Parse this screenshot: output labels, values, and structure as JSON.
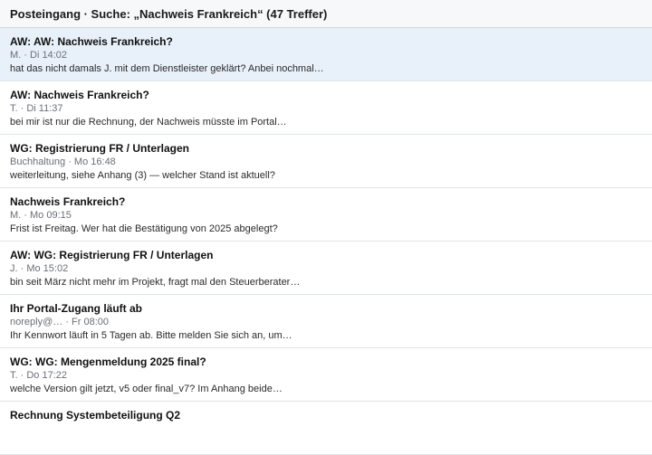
{
  "header": {
    "title": "Posteingang · Suche: „Nachweis Frankreich“ (47 Treffer)"
  },
  "messages": [
    {
      "subject": "AW: AW: Nachweis Frankreich?",
      "meta": "M. · Di 14:02",
      "preview": "hat das nicht damals J. mit dem Dienstleister geklärt? Anbei nochmal…",
      "selected": true
    },
    {
      "subject": "AW: Nachweis Frankreich?",
      "meta": "T. · Di 11:37",
      "preview": "bei mir ist nur die Rechnung, der Nachweis müsste im Portal…"
    },
    {
      "subject": "WG: Registrierung FR / Unterlagen",
      "meta": "Buchhaltung · Mo 16:48",
      "preview": "weiterleitung, siehe Anhang (3) — welcher Stand ist aktuell?"
    },
    {
      "subject": "Nachweis Frankreich?",
      "meta": "M. · Mo 09:15",
      "preview": "Frist ist Freitag. Wer hat die Bestätigung von 2025 abgelegt?"
    },
    {
      "subject": "AW: WG: Registrierung FR / Unterlagen",
      "meta": "J. · Mo 15:02",
      "preview": "bin seit März nicht mehr im Projekt, fragt mal den Steuerberater…"
    },
    {
      "subject": "Ihr Portal-Zugang läuft ab",
      "meta": "noreply@… · Fr 08:00",
      "preview": "Ihr Kennwort läuft in 5 Tagen ab. Bitte melden Sie sich an, um…"
    },
    {
      "subject": "WG: WG: Mengenmeldung 2025 final?",
      "meta": "T. · Do 17:22",
      "preview": "welche Version gilt jetzt, v5 oder final_v7? Im Anhang beide…"
    },
    {
      "subject": "Rechnung Systembeteiligung Q2",
      "meta": "",
      "preview": ""
    }
  ]
}
